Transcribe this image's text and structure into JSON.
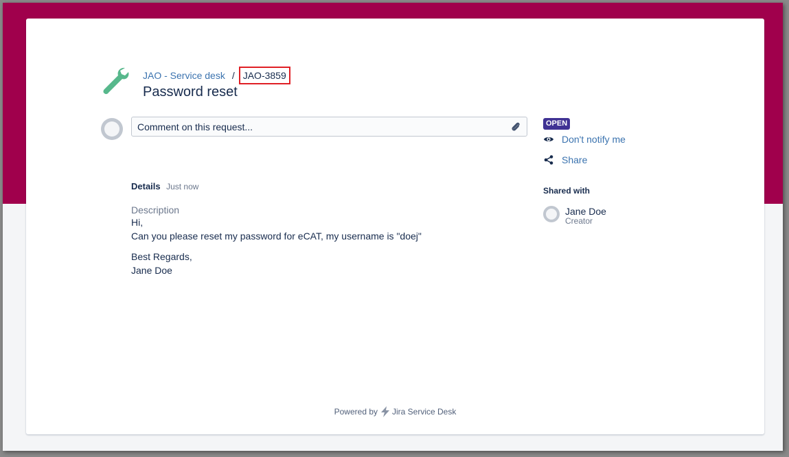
{
  "breadcrumb": {
    "project": "JAO - Service desk",
    "separator": "/",
    "issue_key": "JAO-3859"
  },
  "request": {
    "title": "Password reset"
  },
  "comment": {
    "placeholder": "Comment on this request..."
  },
  "details": {
    "heading": "Details",
    "time": "Just now",
    "description_label": "Description",
    "lines": [
      "Hi,",
      "Can you please reset my password for eCAT, my username is \"doej\"",
      "Best Regards,",
      "Jane Doe"
    ]
  },
  "sidebar": {
    "status": "OPEN",
    "notify_label": "Don't notify me",
    "share_label": "Share",
    "shared_with_heading": "Shared with",
    "shared_user": {
      "name": "Jane Doe",
      "role": "Creator"
    }
  },
  "footer": {
    "powered_by": "Powered by",
    "product": "Jira Service Desk"
  },
  "colors": {
    "banner": "#a0004c",
    "link": "#3b73af",
    "status_badge": "#403294",
    "wrench_icon": "#57b88c",
    "highlight_box": "#e01e24"
  },
  "icons": [
    "wrench-icon",
    "avatar-icon",
    "paperclip-icon",
    "eye-icon",
    "share-icon",
    "jira-logo-icon"
  ]
}
